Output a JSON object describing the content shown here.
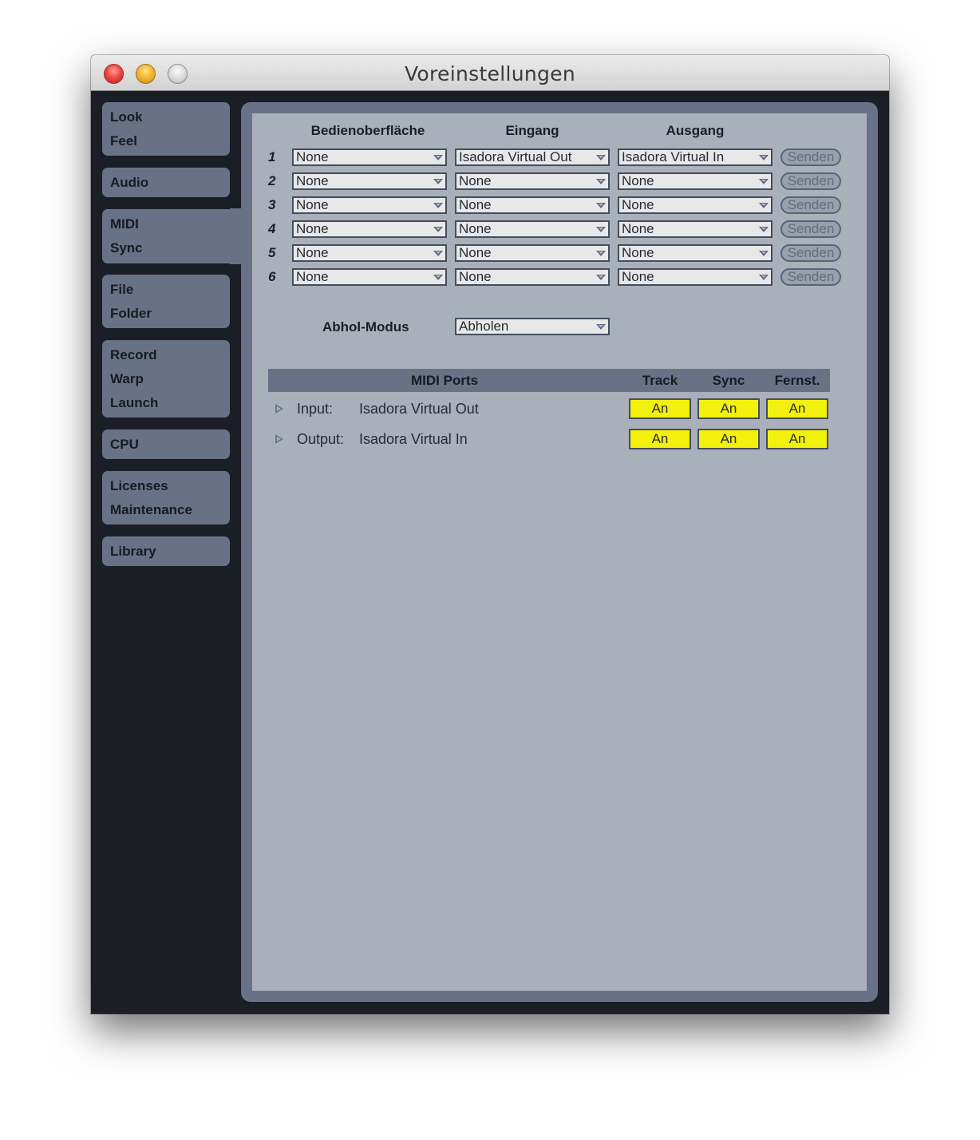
{
  "window": {
    "title": "Voreinstellungen",
    "buttons": [
      "close",
      "minimize",
      "zoom"
    ]
  },
  "sidebar": {
    "items": [
      {
        "lines": [
          "Look",
          "Feel"
        ],
        "active": false
      },
      {
        "lines": [
          "Audio"
        ],
        "active": false
      },
      {
        "lines": [
          "MIDI",
          "Sync"
        ],
        "active": true
      },
      {
        "lines": [
          "File",
          "Folder"
        ],
        "active": false
      },
      {
        "lines": [
          "Record",
          "Warp",
          "Launch"
        ],
        "active": false
      },
      {
        "lines": [
          "CPU"
        ],
        "active": false
      },
      {
        "lines": [
          "Licenses",
          "Maintenance"
        ],
        "active": false
      },
      {
        "lines": [
          "Library"
        ],
        "active": false
      }
    ]
  },
  "control_surfaces": {
    "headers": {
      "surface": "Bedienoberfläche",
      "input": "Eingang",
      "output": "Ausgang"
    },
    "rows": [
      {
        "num": "1",
        "surface": "None",
        "input": "Isadora Virtual Out",
        "output": "Isadora Virtual In",
        "send": "Senden"
      },
      {
        "num": "2",
        "surface": "None",
        "input": "None",
        "output": "None",
        "send": "Senden"
      },
      {
        "num": "3",
        "surface": "None",
        "input": "None",
        "output": "None",
        "send": "Senden"
      },
      {
        "num": "4",
        "surface": "None",
        "input": "None",
        "output": "None",
        "send": "Senden"
      },
      {
        "num": "5",
        "surface": "None",
        "input": "None",
        "output": "None",
        "send": "Senden"
      },
      {
        "num": "6",
        "surface": "None",
        "input": "None",
        "output": "None",
        "send": "Senden"
      }
    ]
  },
  "takeover": {
    "label": "Abhol-Modus",
    "value": "Abholen"
  },
  "midi_ports": {
    "headers": {
      "ports": "MIDI Ports",
      "track": "Track",
      "sync": "Sync",
      "remote": "Fernst."
    },
    "rows": [
      {
        "direction": "Input:",
        "name": "Isadora Virtual Out",
        "track": "An",
        "sync": "An",
        "remote": "An"
      },
      {
        "direction": "Output:",
        "name": "Isadora Virtual In",
        "track": "An",
        "sync": "An",
        "remote": "An"
      }
    ]
  },
  "colors": {
    "toggle_on": "#f2f00d",
    "panel": "#687287",
    "background": "#1b1e25",
    "content": "#aab0b9"
  }
}
